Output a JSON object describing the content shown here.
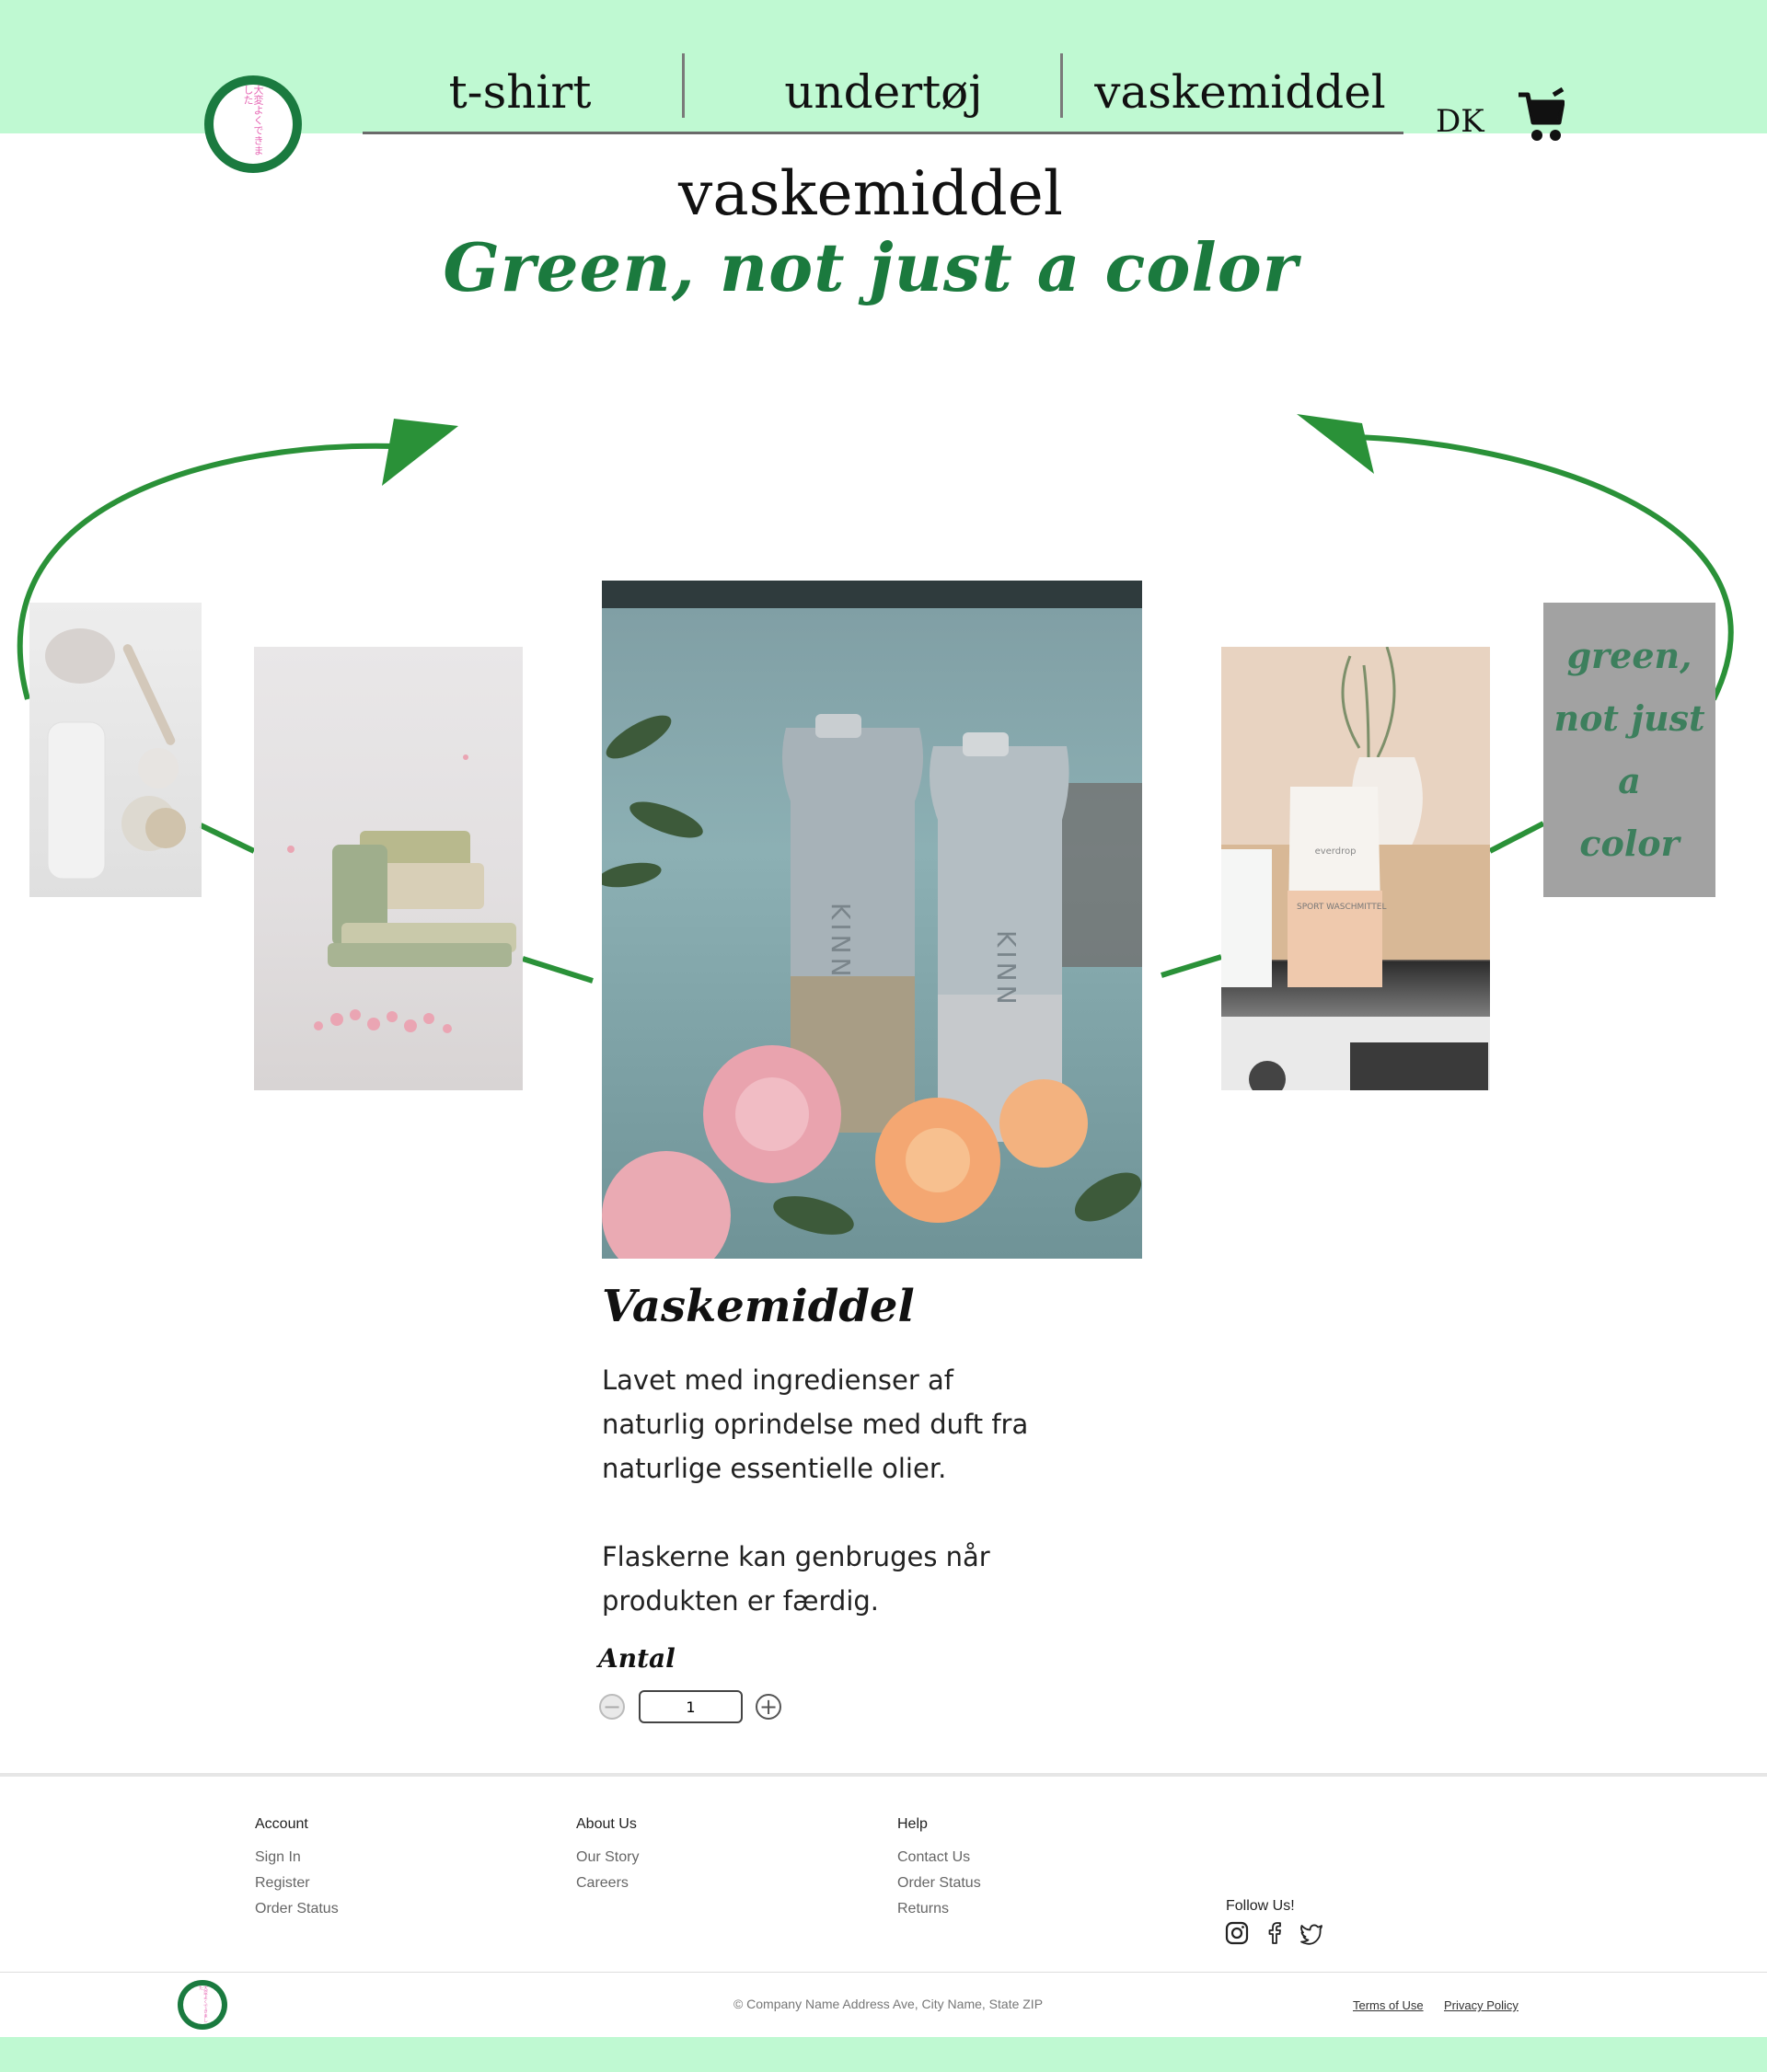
{
  "header": {
    "logo_text": "大変よくできました",
    "nav": [
      {
        "label": "t-shirt"
      },
      {
        "label": "undertøj"
      },
      {
        "label": "vaskemiddel"
      }
    ],
    "language": "DK"
  },
  "main": {
    "page_title": "vaskemiddel",
    "slogan": "Green, not just a color",
    "slogan_card_lines": [
      "green,",
      "not just",
      "a",
      "color"
    ],
    "product": {
      "name": "Vaskemiddel",
      "description_1": "Lavet med ingredienser af naturlig oprindelse med duft fra naturlige essentielle olier.",
      "description_2": "Flaskerne kan genbruges når produkten er færdig.",
      "quantity_label": "Antal",
      "quantity_value": "1",
      "bottle_brand": "KINN"
    },
    "photo_labels": {
      "right_package_brand": "everdrop",
      "right_package_title": "SPORT WASCHMITTEL"
    }
  },
  "footer": {
    "columns": [
      {
        "title": "Account",
        "links": [
          "Sign In",
          "Register",
          "Order Status"
        ]
      },
      {
        "title": "About Us",
        "links": [
          "Our Story",
          "Careers"
        ]
      },
      {
        "title": "Help",
        "links": [
          "Contact Us",
          "Order Status",
          "Returns"
        ]
      }
    ],
    "follow_label": "Follow Us!",
    "social_icons": [
      "instagram-icon",
      "facebook-icon",
      "twitter-icon"
    ],
    "copyright": "© Company Name Address Ave, City Name, State ZIP",
    "terms": "Terms of Use",
    "privacy": "Privacy Policy"
  },
  "colors": {
    "header_band": "#bff9d2",
    "brand_green": "#1b7a3e",
    "arrow_green": "#2a9138"
  }
}
